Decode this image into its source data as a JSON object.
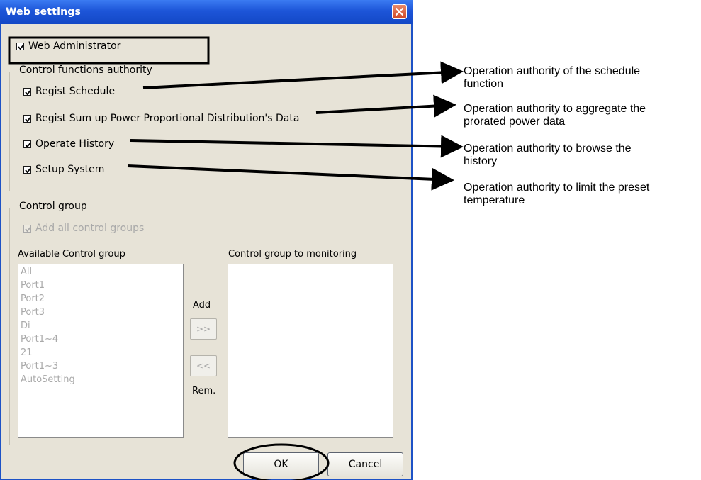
{
  "window": {
    "title": "Web settings"
  },
  "admin": {
    "label": "Web Administrator",
    "checked": true
  },
  "control_functions": {
    "legend": "Control functions authority",
    "items": [
      {
        "label": "Regist Schedule",
        "checked": true
      },
      {
        "label": "Regist Sum up Power Proportional Distribution's Data",
        "checked": true
      },
      {
        "label": "Operate History",
        "checked": true
      },
      {
        "label": "Setup System",
        "checked": true
      }
    ]
  },
  "control_group": {
    "legend": "Control group",
    "add_all": {
      "label": "Add all control groups",
      "checked": true,
      "disabled": true
    },
    "available_label": "Available Control group",
    "monitoring_label": "Control group to monitoring",
    "available_items": [
      "All",
      "Port1",
      "Port2",
      "Port3",
      "Di",
      "Port1~4",
      "21",
      "Port1~3",
      "AutoSetting"
    ],
    "add_label": "Add",
    "add_button": ">>",
    "remove_button": "<<",
    "remove_label": "Rem."
  },
  "buttons": {
    "ok": "OK",
    "cancel": "Cancel"
  },
  "annotations": [
    {
      "line1": "Operation authority of the schedule",
      "line2": "function"
    },
    {
      "line1": "Operation authority to aggregate the",
      "line2": "prorated power data"
    },
    {
      "line1": "Operation authority to browse the",
      "line2": "history"
    },
    {
      "line1": "Operation authority to limit the preset",
      "line2": "temperature"
    }
  ],
  "colors": {
    "titlebar": "#1d55d8",
    "dialog_bg": "#e7e3d7",
    "close": "#cf4a28"
  }
}
